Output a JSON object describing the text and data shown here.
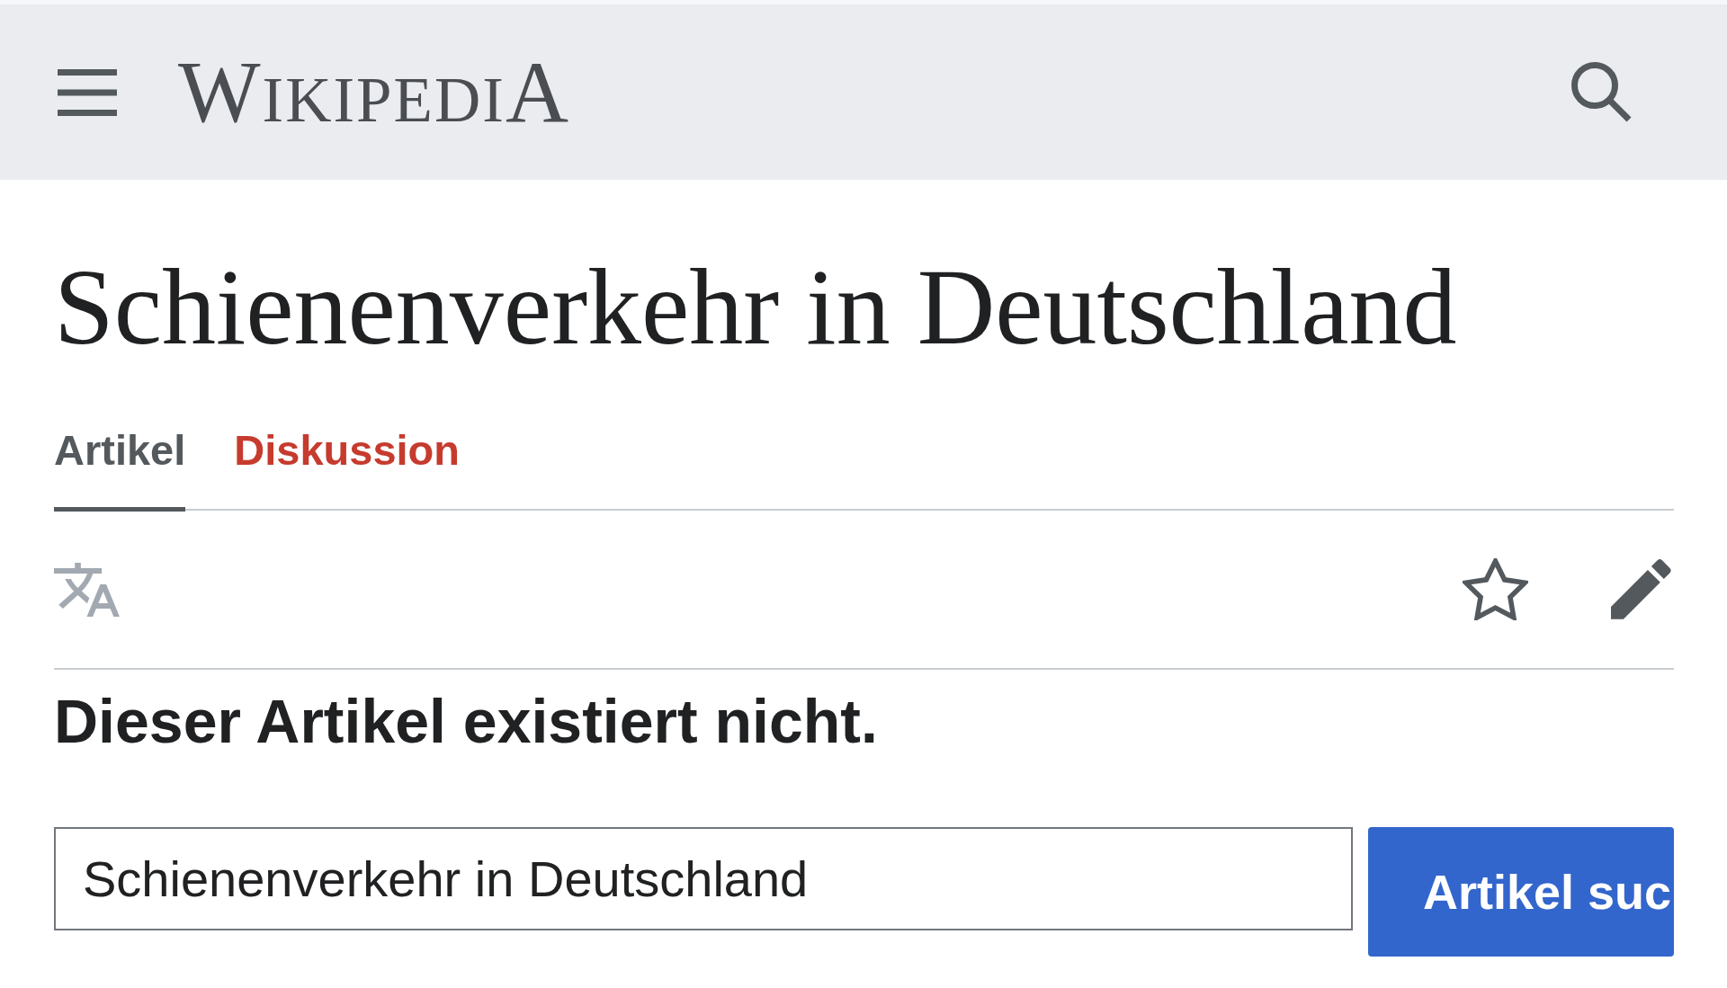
{
  "header": {
    "logo": "WIKIPEDIA"
  },
  "page": {
    "title": "Schienenverkehr in Deutschland"
  },
  "tabs": [
    {
      "label": "Artikel",
      "selected": true,
      "red_link": false
    },
    {
      "label": "Diskussion",
      "selected": false,
      "red_link": true
    }
  ],
  "toolbar": {
    "starred": false
  },
  "message": "Dieser Artikel existiert nicht.",
  "search_form": {
    "value": "Schienenverkehr in Deutschland",
    "button": "Artikel suc"
  }
}
